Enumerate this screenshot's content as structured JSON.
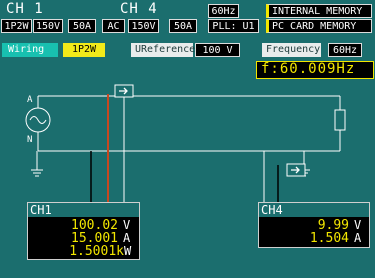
{
  "header": {
    "ch1": {
      "name": "CH 1",
      "mode": "1P2W",
      "range": "150V",
      "current": "50A"
    },
    "ch4": {
      "name": "CH 4",
      "mode": "AC",
      "range": "150V",
      "current": "50A"
    },
    "pll": {
      "freq": "60Hz",
      "source": "PLL: U1"
    },
    "memory": {
      "internal": "INTERNAL MEMORY",
      "pccard": "PC CARD  MEMORY"
    }
  },
  "settings": {
    "wiring_label": "Wiring",
    "wiring_value": "1P2W",
    "ureference_label": "UReference",
    "ureference_value": "100 V",
    "frequency_label": "Frequency",
    "frequency_value": "60Hz",
    "f_readout": "f:60.009Hz"
  },
  "diagram": {
    "label_a": "A",
    "label_n": "N"
  },
  "ch1_panel": {
    "title": "CH1",
    "rows": [
      {
        "value": "100.02",
        "unit": "V"
      },
      {
        "value": "15.001",
        "unit": "A"
      },
      {
        "value": "1.5001k",
        "unit": "W"
      }
    ]
  },
  "ch4_panel": {
    "title": "CH4",
    "rows": [
      {
        "value": "9.99",
        "unit": "V"
      },
      {
        "value": "1.504",
        "unit": "A"
      }
    ]
  },
  "colors": {
    "background": "#1b6e6e",
    "readout_yellow": "#f2e600",
    "accent_green": "#18c0b0",
    "line_white": "#ffffff",
    "current_wire": "#c84820"
  }
}
